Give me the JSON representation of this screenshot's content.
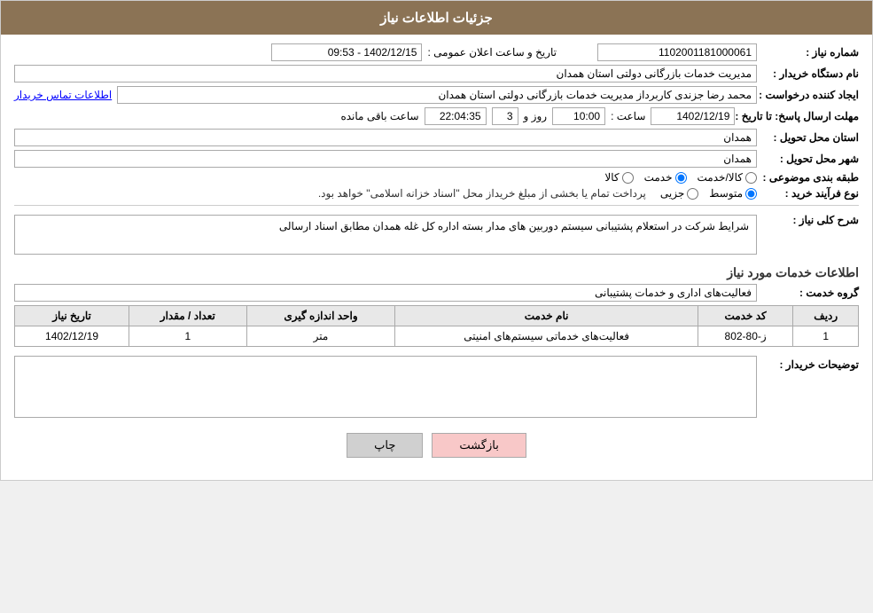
{
  "header": {
    "title": "جزئیات اطلاعات نیاز"
  },
  "fields": {
    "shomareNiaz_label": "شماره نیاز :",
    "shomareNiaz_value": "1102001181000061",
    "namDastgah_label": "نام دستگاه خریدار :",
    "namDastgah_value": "مدیریت خدمات بازرگانی دولتی استان همدان",
    "ijadKonande_label": "ایجاد کننده درخواست :",
    "ijadKonande_value": "محمد رضا  جزندی کاربرداز مدیریت خدمات بازرگانی دولتی استان همدان",
    "ijadKonande_link": "اطلاعات تماس خریدار",
    "mohlat_label": "مهلت ارسال پاسخ: تا تاریخ :",
    "date_value": "1402/12/19",
    "saaat_label": "ساعت :",
    "saaat_value": "10:00",
    "rooz_label": "روز و",
    "rooz_value": "3",
    "mandeh_label": "ساعت باقی مانده",
    "mandeh_value": "22:04:35",
    "tarikhAelan_label": "تاریخ و ساعت اعلان عمومی :",
    "tarikhAelan_value": "1402/12/15 - 09:53",
    "ostan_label": "استان محل تحویل :",
    "ostan_value": "همدان",
    "shahr_label": "شهر محل تحویل :",
    "shahr_value": "همدان",
    "tabaqe_label": "طبقه بندی موضوعی :",
    "tabaqe_kala": "کالا",
    "tabaqe_khadamat": "خدمت",
    "tabaqe_kala_khadamat": "کالا/خدمت",
    "tabaqe_selected": "خدمت",
    "noeFarayand_label": "نوع فرآیند خرید :",
    "noeFarayand_jozii": "جزیی",
    "noeFarayand_motavaset": "متوسط",
    "noeFarayand_note": "پرداخت تمام یا بخشی از مبلغ خریداز محل \"اسناد خزانه اسلامی\" خواهد بود.",
    "noeFarayand_selected": "متوسط",
    "sharhKoli_label": "شرح کلی نیاز :",
    "sharhKoli_value": "شرایط شرکت در استعلام پشتیبانی سیستم دوربین های مدار بسته اداره کل غله همدان مطابق اسناد ارسالی",
    "khadamatTitle": "اطلاعات خدمات مورد نیاز",
    "grohKhadamat_label": "گروه خدمت :",
    "grohKhadamat_value": "فعالیت‌های اداری و خدمات پشتیبانی",
    "table": {
      "headers": [
        "ردیف",
        "کد خدمت",
        "نام خدمت",
        "واحد اندازه گیری",
        "تعداد / مقدار",
        "تاریخ نیاز"
      ],
      "rows": [
        {
          "radif": "1",
          "code": "ز-80-802",
          "name": "فعالیت‌های خدماتی سیستم‌های امنیتی",
          "vahed": "متر",
          "tedad": "1",
          "tarikh": "1402/12/19"
        }
      ]
    },
    "tosif_label": "توضیحات خریدار :",
    "tosif_value": ""
  },
  "buttons": {
    "print": "چاپ",
    "back": "بازگشت"
  }
}
